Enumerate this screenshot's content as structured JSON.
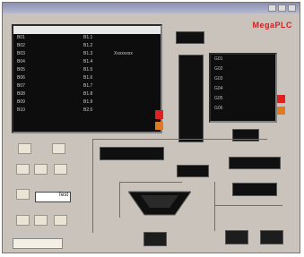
{
  "window": {
    "brand": "MegaPLC"
  },
  "left_panel": {
    "rows": [
      {
        "c1": "B01",
        "c2": "B1.1",
        "c3": ""
      },
      {
        "c1": "B02",
        "c2": "B1.2",
        "c3": ""
      },
      {
        "c1": "B03",
        "c2": "B1.3",
        "c3": "Xxxxxxxx"
      },
      {
        "c1": "B04",
        "c2": "B1.4",
        "c3": ""
      },
      {
        "c1": "B05",
        "c2": "B1.5",
        "c3": ""
      },
      {
        "c1": "B06",
        "c2": "B1.6",
        "c3": ""
      },
      {
        "c1": "B07",
        "c2": "B1.7",
        "c3": ""
      },
      {
        "c1": "B08",
        "c2": "B1.8",
        "c3": ""
      },
      {
        "c1": "B09",
        "c2": "B1.9",
        "c3": ""
      },
      {
        "c1": "B10",
        "c2": "B2.0",
        "c3": ""
      }
    ]
  },
  "right_panel": {
    "rows": [
      "G01",
      "G02",
      "G03",
      "G04",
      "G05",
      "G06"
    ]
  },
  "keypad": {
    "input_value": "Test"
  },
  "colors": {
    "scroll_red": "#e02020",
    "scroll_orange": "#e07a20",
    "brand": "#d02020"
  }
}
